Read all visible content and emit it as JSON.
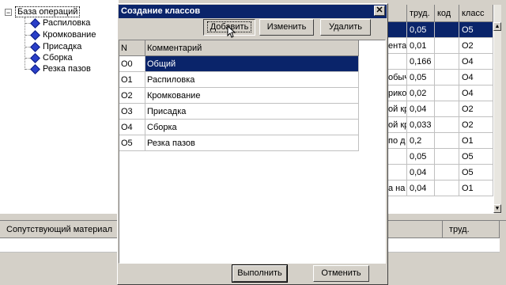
{
  "tree": {
    "root_label": "База операций",
    "expander": "−",
    "items": [
      "Распиловка",
      "Кромкование",
      "Присадка",
      "Сборка",
      "Резка пазов"
    ]
  },
  "grid": {
    "headers": [
      "",
      "труд.",
      "код",
      "класс"
    ],
    "rows": [
      [
        "",
        "0,05",
        "",
        "O5"
      ],
      [
        "ента",
        "0,01",
        "",
        "O2"
      ],
      [
        "",
        "0,166",
        "",
        "O4"
      ],
      [
        "обыч",
        "0,05",
        "",
        "O4"
      ],
      [
        "рико",
        "0,02",
        "",
        "O4"
      ],
      [
        "ой кр",
        "0,04",
        "",
        "O2"
      ],
      [
        "ой кр",
        "0,033",
        "",
        "O2"
      ],
      [
        "по д",
        "0,2",
        "",
        "O1"
      ],
      [
        "",
        "0,05",
        "",
        "O5"
      ],
      [
        "",
        "0,04",
        "",
        "O5"
      ],
      [
        "а на у",
        "0,04",
        "",
        "O1"
      ]
    ]
  },
  "bottom": {
    "col1": "Сопутствующий материал",
    "col2": "труд."
  },
  "dialog": {
    "title": "Создание классов",
    "close": "✕",
    "buttons": {
      "add": "Добавить",
      "edit": "Изменить",
      "delete": "Удалить"
    },
    "table": {
      "headers": [
        "N",
        "Комментарий"
      ],
      "rows": [
        [
          "O0",
          "Общий"
        ],
        [
          "O1",
          "Распиловка"
        ],
        [
          "O2",
          "Кромкование"
        ],
        [
          "O3",
          "Присадка"
        ],
        [
          "O4",
          "Сборка"
        ],
        [
          "O5",
          "Резка пазов"
        ]
      ]
    },
    "footer": {
      "ok": "Выполнить",
      "cancel": "Отменить"
    }
  },
  "colors": {
    "selection": "#0a246a",
    "face": "#d4d0c8",
    "tree_icon": "#2a3fc8"
  }
}
